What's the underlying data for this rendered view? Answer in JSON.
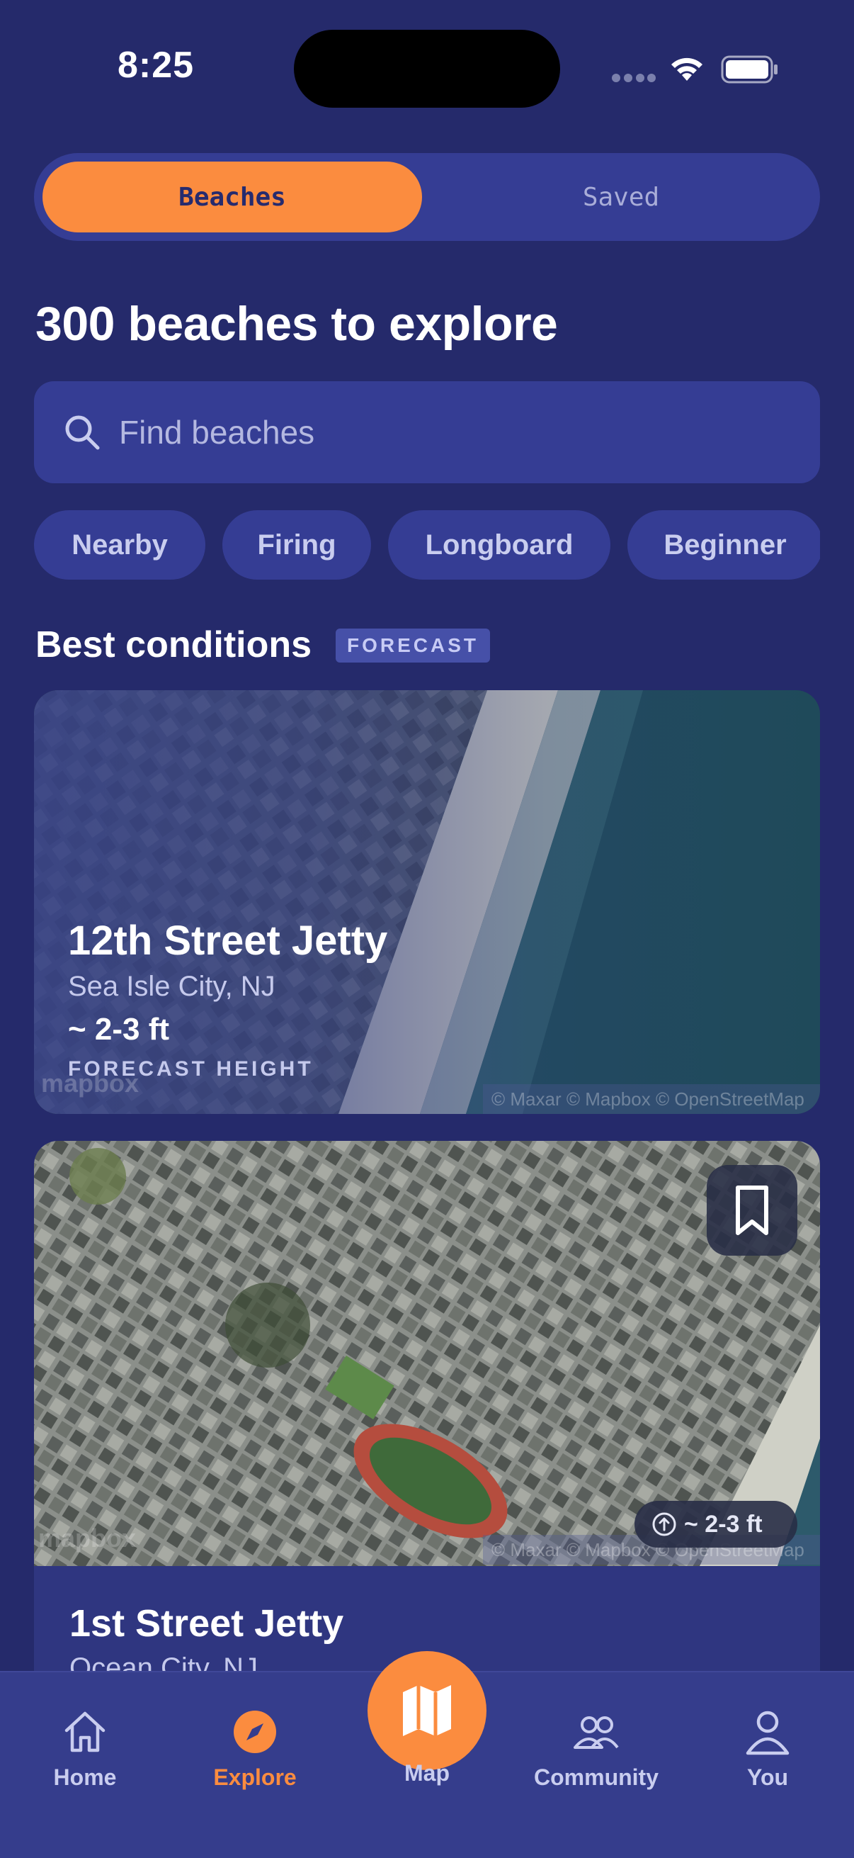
{
  "status_bar": {
    "time": "8:25"
  },
  "segments": {
    "beaches": "Beaches",
    "saved": "Saved"
  },
  "page_title": "300 beaches to explore",
  "search": {
    "placeholder": "Find beaches"
  },
  "filter_chips": [
    "Nearby",
    "Firing",
    "Longboard",
    "Beginner"
  ],
  "section": {
    "title": "Best conditions",
    "badge": "FORECAST"
  },
  "cards": [
    {
      "name": "12th Street Jetty",
      "location": "Sea Isle City, NJ",
      "height": "~ 2-3 ft",
      "height_label": "FORECAST HEIGHT",
      "map_logo": "mapbox",
      "attribution": "© Maxar © Mapbox © OpenStreetMap"
    },
    {
      "name": "1st Street Jetty",
      "location": "Ocean City, NJ",
      "height": "~ 2-3 ft",
      "map_logo": "mapbox",
      "attribution": "© Maxar © Mapbox © OpenStreetMap"
    }
  ],
  "tabs": {
    "home": "Home",
    "explore": "Explore",
    "map": "Map",
    "community": "Community",
    "you": "You"
  },
  "colors": {
    "background": "#252a6b",
    "surface": "#353d94",
    "accent": "#fb8c3f",
    "muted_text": "#c9cdef"
  },
  "icons": {
    "search": "search-icon",
    "bookmark": "bookmark-icon",
    "arrow_up": "arrow-up-circle-icon",
    "home": "home-icon",
    "explore": "compass-icon",
    "map": "map-icon",
    "community": "people-icon",
    "you": "person-icon"
  }
}
